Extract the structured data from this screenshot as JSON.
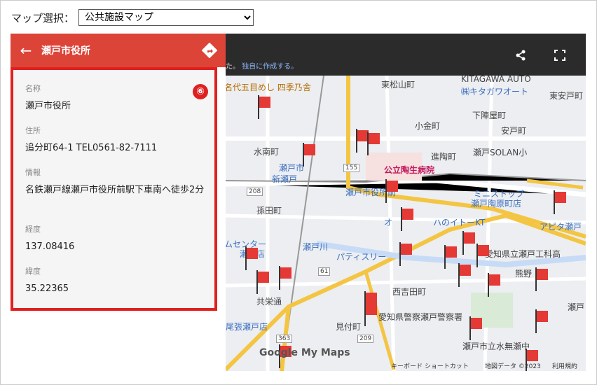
{
  "map_select": {
    "label": "マップ選択：",
    "selected": "公共施設マップ"
  },
  "toolbar": {
    "note_prefix": "た。",
    "note_link": "独自に作成する。"
  },
  "panel": {
    "title": "瀬戸市役所",
    "badge": "⑥",
    "fields": [
      {
        "label": "名称",
        "value": "瀬戸市役所"
      },
      {
        "label": "住所",
        "value": "追分町64-1 TEL0561-82-7111"
      },
      {
        "label": "情報",
        "value": "名鉄瀬戸線瀬戸市役所前駅下車南へ徒歩2分"
      },
      {
        "label": "経度",
        "value": "137.08416"
      },
      {
        "label": "緯度",
        "value": "35.22365"
      }
    ]
  },
  "map": {
    "labels": [
      {
        "text": "名代五目めし 四季乃舎",
        "kind": "poi"
      },
      {
        "text": "東松山町",
        "kind": "road"
      },
      {
        "text": "KITAGAWA AUTO",
        "kind": "road"
      },
      {
        "text": "㈱キタガワオート",
        "kind": "poi"
      },
      {
        "text": "東安戸町",
        "kind": "road"
      },
      {
        "text": "下陣屋町",
        "kind": "road"
      },
      {
        "text": "小金町",
        "kind": "road"
      },
      {
        "text": "安戸町",
        "kind": "road"
      },
      {
        "text": "水南町",
        "kind": "road"
      },
      {
        "text": "進陶町",
        "kind": "road"
      },
      {
        "text": "瀬戸SOLAN小",
        "kind": "road"
      },
      {
        "text": "瀬戸市",
        "kind": "poi"
      },
      {
        "text": "新瀬戸",
        "kind": "poi"
      },
      {
        "text": "公立陶生病院",
        "kind": "road"
      },
      {
        "text": "瀬戸市役所前",
        "kind": "poi"
      },
      {
        "text": "ミニストップ",
        "kind": "poi"
      },
      {
        "text": "瀬戸陶原町店",
        "kind": "poi"
      },
      {
        "text": "孫田町",
        "kind": "road"
      },
      {
        "text": "オ",
        "kind": "poi"
      },
      {
        "text": "ハのイトーKT",
        "kind": "poi"
      },
      {
        "text": "アピタ瀬戸",
        "kind": "poi"
      },
      {
        "text": "瀬戸川",
        "kind": "poi"
      },
      {
        "text": "パティスリー",
        "kind": "poi"
      },
      {
        "text": "愛知県立瀬戸工科高",
        "kind": "road"
      },
      {
        "text": "熊野",
        "kind": "road"
      },
      {
        "text": "西吉田町",
        "kind": "road"
      },
      {
        "text": "共栄通",
        "kind": "road"
      },
      {
        "text": "愛知県警察瀬戸警察署",
        "kind": "road"
      },
      {
        "text": "見付町",
        "kind": "road"
      },
      {
        "text": "瀬戸市立水無瀬中",
        "kind": "road"
      },
      {
        "text": "尾張瀬戸店",
        "kind": "poi"
      },
      {
        "text": "ムセンター",
        "kind": "poi"
      },
      {
        "text": "瀬戸店",
        "kind": "poi"
      },
      {
        "text": "瀬戸",
        "kind": "road"
      }
    ],
    "road_numbers": [
      "155",
      "208",
      "61",
      "209",
      "363"
    ],
    "logo": "Google My Maps",
    "footer": {
      "shortcuts": "キーボード ショートカット",
      "mapdata": "地図データ ©2023",
      "terms": "利用規約"
    }
  }
}
